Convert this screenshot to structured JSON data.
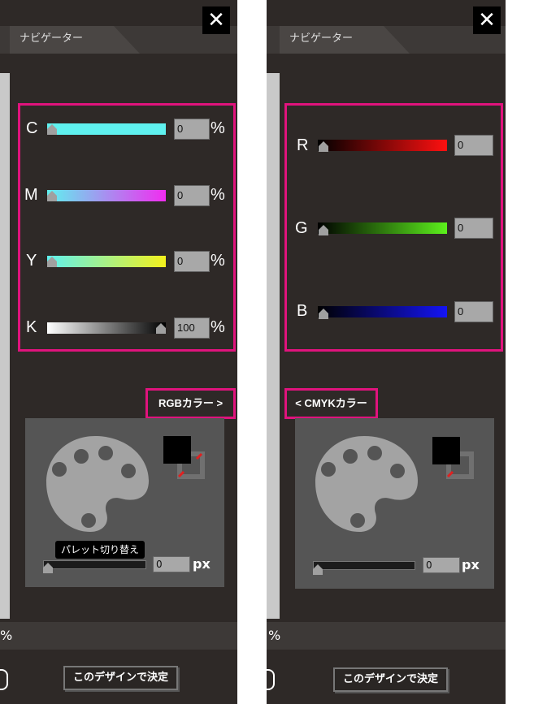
{
  "close_glyph": "✕",
  "navigator_label": "ナビゲーター",
  "left": {
    "channels": [
      {
        "label": "C",
        "value": "0",
        "unit": "%",
        "level": 0
      },
      {
        "label": "M",
        "value": "0",
        "unit": "%",
        "level": 0
      },
      {
        "label": "Y",
        "value": "0",
        "unit": "%",
        "level": 0
      },
      {
        "label": "K",
        "value": "100",
        "unit": "%",
        "level": 100
      }
    ],
    "switch_label": "RGBカラー >",
    "tooltip": "パレット切り替え",
    "px_value": "0",
    "px_unit": "px",
    "pct_text": "%",
    "confirm_label": "このデザインで決定"
  },
  "right": {
    "channels": [
      {
        "label": "R",
        "value": "0",
        "level": 0
      },
      {
        "label": "G",
        "value": "0",
        "level": 0
      },
      {
        "label": "B",
        "value": "0",
        "level": 0
      }
    ],
    "switch_label": "< CMYKカラー",
    "px_value": "0",
    "px_unit": "px",
    "pct_text": "%",
    "confirm_label": "このデザインで決定"
  },
  "colors": {
    "highlight": "#e0137d",
    "panel_bg": "#2e2927",
    "preview_bg": "#555555",
    "palette_icon": "#a3a3a3"
  },
  "icons": {
    "close": "close-icon",
    "palette": "palette-icon",
    "swap": "swap-colors-icon"
  }
}
